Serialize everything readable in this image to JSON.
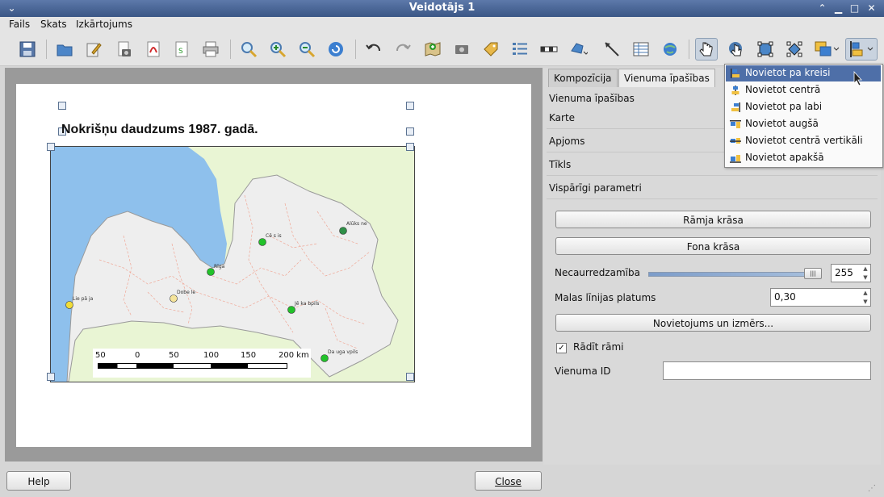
{
  "window": {
    "title": "Veidotājs 1"
  },
  "menubar": {
    "items": [
      "Fails",
      "Skats",
      "Izkārtojums"
    ]
  },
  "composer": {
    "page_title": "Nokrišņu daudzums 1987. gadā.",
    "map": {
      "cities": [
        {
          "name": "Alūks ne",
          "color": "#2f8f47"
        },
        {
          "name": "Cē s is",
          "color": "#22c22a"
        },
        {
          "name": "Rīga",
          "color": "#22c22a"
        },
        {
          "name": "Dobe le",
          "color": "#f5e49a"
        },
        {
          "name": "Lie pā ja",
          "color": "#f0dc38"
        },
        {
          "name": "Jē ka bpils",
          "color": "#22c22a"
        },
        {
          "name": "Da uga vpils",
          "color": "#22c22a"
        }
      ],
      "scalebar": {
        "labels": [
          "50",
          "0",
          "50",
          "100",
          "150",
          "200 km"
        ]
      }
    }
  },
  "panel": {
    "tabs": [
      "Kompozīcija",
      "Vienuma īpašības"
    ],
    "heading": "Vienuma īpašības",
    "sections": [
      "Karte",
      "Apjoms",
      "Tīkls",
      "Vispārīgi parametri"
    ],
    "frame_color_button": "Rāmja krāsa",
    "background_color_button": "Fona krāsa",
    "opacity_label": "Necaurredzamība",
    "opacity_value": "255",
    "outline_width_label": "Malas līnijas platums",
    "outline_width_value": "0,30",
    "position_size_button": "Novietojums un izmērs...",
    "show_frame_label": "Rādīt rāmi",
    "show_frame_checked": true,
    "item_id_label": "Vienuma ID",
    "item_id_value": ""
  },
  "align_menu": {
    "items": [
      "Novietot pa kreisi",
      "Novietot centrā",
      "Novietot pa labi",
      "Novietot augšā",
      "Novietot centrā vertikāli",
      "Novietot apakšā"
    ],
    "highlighted_index": 0
  },
  "bottom": {
    "help_button": "Help",
    "close_button": "Close"
  },
  "colors": {
    "titlebar": "#3a5685",
    "highlight": "#4e6fa8",
    "water": "#7db7ea",
    "land": "#eeeeee"
  }
}
